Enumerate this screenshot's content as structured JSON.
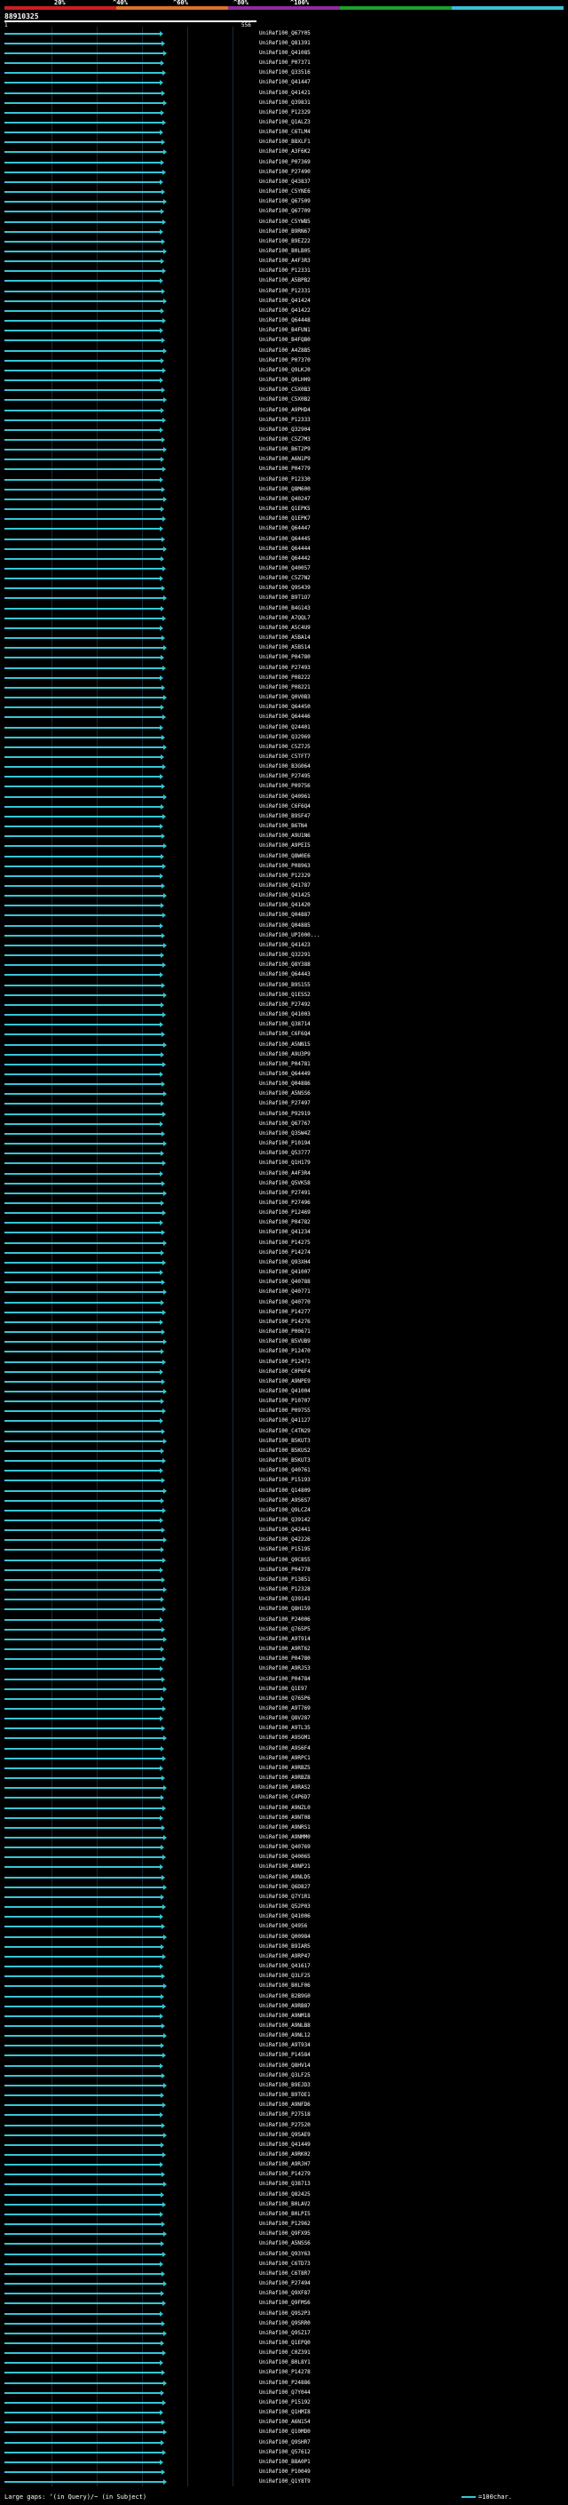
{
  "header": {
    "scale_labels": [
      "20%",
      "^40%",
      "^60%",
      "^80%",
      "^100%"
    ],
    "scale_colors": [
      "#d01c25",
      "#e0702a",
      "#8e2d9c",
      "#1aa12d",
      "#3bbfd8"
    ],
    "query_id": "88910325",
    "pos_start": "1",
    "pos_end": "556"
  },
  "colors": {
    "hit": "#35c6d6",
    "grid": "#1a2b36"
  },
  "labels": [
    "UniRef100_Q67Y05",
    "UniRef100_Q81391",
    "UniRef100_Q41085",
    "UniRef100_P07371",
    "UniRef100_Q33516",
    "UniRef100_Q41447",
    "UniRef100_Q41421",
    "UniRef100_Q39831",
    "UniRef100_P12329",
    "UniRef100_Q1ALZ3",
    "UniRef100_C6TLM4",
    "UniRef100_B8XLF1",
    "UniRef100_A3F6K2",
    "UniRef100_P07369",
    "UniRef100_P27490",
    "UniRef100_Q43837",
    "UniRef100_C5YNE6",
    "UniRef100_Q67509",
    "UniRef100_Q67709",
    "UniRef100_C5YWB5",
    "UniRef100_B9RN67",
    "UniRef100_B9EZ22",
    "UniRef100_B0LB05",
    "UniRef100_A4F3R3",
    "UniRef100_P12331",
    "UniRef100_A5BPB2",
    "UniRef100_P12331",
    "UniRef100_Q41424",
    "UniRef100_Q41422",
    "UniRef100_Q64448",
    "UniRef100_B4FUN1",
    "UniRef100_B4FQB0",
    "UniRef100_A4Z8B5",
    "UniRef100_P07370",
    "UniRef100_Q9LKJ0",
    "UniRef100_Q0LHH9",
    "UniRef100_C5X0B3",
    "UniRef100_C5X0B2",
    "UniRef100_A9PHD4",
    "UniRef100_P12333",
    "UniRef100_Q32904",
    "UniRef100_C5Z7M3",
    "UniRef100_B6T2P9",
    "UniRef100_A6N1P9",
    "UniRef100_P04779",
    "UniRef100_P12330",
    "UniRef100_Q8M600",
    "UniRef100_Q40247",
    "UniRef100_Q1EPK5",
    "UniRef100_Q1EPK7",
    "UniRef100_Q64447",
    "UniRef100_Q64445",
    "UniRef100_Q64444",
    "UniRef100_Q64442",
    "UniRef100_Q40057",
    "UniRef100_C5Z7N2",
    "UniRef100_Q9S439",
    "UniRef100_B9T1O7",
    "UniRef100_B4G143",
    "UniRef100_A7QQL7",
    "UniRef100_A5C4U9",
    "UniRef100_A5BA14",
    "UniRef100_A5BS14",
    "UniRef100_P04780",
    "UniRef100_P27493",
    "UniRef100_P08222",
    "UniRef100_P08221",
    "UniRef100_Q0V0B3",
    "UniRef100_Q64450",
    "UniRef100_Q64446",
    "UniRef100_Q24401",
    "UniRef100_Q32969",
    "UniRef100_C5Z7J5",
    "UniRef100_C5TFT7",
    "UniRef100_B3G064",
    "UniRef100_P27495",
    "UniRef100_P09756",
    "UniRef100_Q40961",
    "UniRef100_C6F6Q4",
    "UniRef100_B9SF47",
    "UniRef100_B6TN4",
    "UniRef100_A9U1N6",
    "UniRef100_A9PEI5",
    "UniRef100_Q8W0E6",
    "UniRef100_P08963",
    "UniRef100_P12329",
    "UniRef100_Q41787",
    "UniRef100_Q41425",
    "UniRef100_Q41420",
    "UniRef100_Q04887",
    "UniRef100_Q04885",
    "UniRef100_UPI000...",
    "UniRef100_Q41423",
    "UniRef100_Q32291",
    "UniRef100_Q8Y388",
    "UniRef100_Q64443",
    "UniRef100_B9S155",
    "UniRef100_Q1ESS2",
    "UniRef100_P27492",
    "UniRef100_Q41003",
    "UniRef100_Q38714",
    "UniRef100_C6F6Q4",
    "UniRef100_A5NN15",
    "UniRef100_A9U3P9",
    "UniRef100_P04781",
    "UniRef100_Q64449",
    "UniRef100_Q04886",
    "UniRef100_A5NSS6",
    "UniRef100_P27497",
    "UniRef100_P92919",
    "UniRef100_Q67767",
    "UniRef100_Q3SW4Z",
    "UniRef100_P10194",
    "UniRef100_Q53777",
    "UniRef100_Q1H179",
    "UniRef100_A4F3R4",
    "UniRef100_Q5VK58",
    "UniRef100_P27491",
    "UniRef100_P27496",
    "UniRef100_P12469",
    "UniRef100_P04782",
    "UniRef100_Q41234",
    "UniRef100_P14275",
    "UniRef100_P14274",
    "UniRef100_Q93XH4",
    "UniRef100_Q41007",
    "UniRef100_Q40788",
    "UniRef100_Q40771",
    "UniRef100_Q40770",
    "UniRef100_P14277",
    "UniRef100_P14276",
    "UniRef100_P00671",
    "UniRef100_B5VUB9",
    "UniRef100_P12470",
    "UniRef100_P12471",
    "UniRef100_C0P6F4",
    "UniRef100_A9NPE9",
    "UniRef100_Q41004",
    "UniRef100_P10707",
    "UniRef100_P09755",
    "UniRef100_Q41127",
    "UniRef100_C4TN29",
    "UniRef100_B5KUT3",
    "UniRef100_B5KUS2",
    "UniRef100_B5KUT3",
    "UniRef100_Q40761",
    "UniRef100_P15193",
    "UniRef100_Q14809",
    "UniRef100_A9S6S7",
    "UniRef100_Q9LCZ4",
    "UniRef100_Q39142",
    "UniRef100_Q42441",
    "UniRef100_Q42226",
    "UniRef100_P15195",
    "UniRef100_Q9C8S5",
    "UniRef100_P04778",
    "UniRef100_P13851",
    "UniRef100_P12328",
    "UniRef100_Q39141",
    "UniRef100_Q8H159",
    "UniRef100_P24006",
    "UniRef100_Q765P5",
    "UniRef100_A9T914",
    "UniRef100_A9RT62",
    "UniRef100_P04780",
    "UniRef100_A9RJ53",
    "UniRef100_P04784",
    "UniRef100_Q1E97",
    "UniRef100_Q765P6",
    "UniRef100_A9T769",
    "UniRef100_Q8V287",
    "UniRef100_A9TL35",
    "UniRef100_A9SGM1",
    "UniRef100_A9S6F4",
    "UniRef100_A9RPC1",
    "UniRef100_A9RBZ5",
    "UniRef100_A9RBZ8",
    "UniRef100_A9RAS2",
    "UniRef100_C4P6D7",
    "UniRef100_A9NZL0",
    "UniRef100_A9NT08",
    "UniRef100_A9NRS1",
    "UniRef100_A9NMM0",
    "UniRef100_Q40769",
    "UniRef100_Q40065",
    "UniRef100_A9NP21",
    "UniRef100_A9NLD5",
    "UniRef100_Q6D827",
    "UniRef100_Q7Y1R1",
    "UniRef100_Q52P03",
    "UniRef100_Q41006",
    "UniRef100_Q4956",
    "UniRef100_Q00984",
    "UniRef100_B9IAR5",
    "UniRef100_A9RP47",
    "UniRef100_Q41617",
    "UniRef100_Q3LF25",
    "UniRef100_B0LF06",
    "UniRef100_B2B9G0",
    "UniRef100_A9RB87",
    "UniRef100_A9NM18",
    "UniRef100_A9NLB8",
    "UniRef100_A9NL12",
    "UniRef100_A9T934",
    "UniRef100_P14584",
    "UniRef100_Q8HV14",
    "UniRef100_Q3LF25",
    "UniRef100_B9EJD3",
    "UniRef100_B9TOE1",
    "UniRef100_A9NFD6",
    "UniRef100_P27518",
    "UniRef100_P27520",
    "UniRef100_Q9SAE9",
    "UniRef100_Q41449",
    "UniRef100_A9RK02",
    "UniRef100_A9RJH7",
    "UniRef100_P14279",
    "UniRef100_Q38713",
    "UniRef100_Q82425",
    "UniRef100_B0LAV2",
    "UniRef100_B0LPI5",
    "UniRef100_P12962",
    "UniRef100_Q9FX95",
    "UniRef100_A5NSS6",
    "UniRef100_Q93Y63",
    "UniRef100_C6TD73",
    "UniRef100_C6T8R7",
    "UniRef100_P27494",
    "UniRef100_Q9XF87",
    "UniRef100_Q9FMS6",
    "UniRef100_Q9S2P3",
    "UniRef100_Q9SRR0",
    "UniRef100_Q9SZ17",
    "UniRef100_Q1EPQ0",
    "UniRef100_C0Z391",
    "UniRef100_B0L8Y1",
    "UniRef100_P14278",
    "UniRef100_P24886",
    "UniRef100_Q7Y044",
    "UniRef100_P15192",
    "UniRef100_Q1HMI8",
    "UniRef100_A6N154",
    "UniRef100_Q10MD0",
    "UniRef100_Q9SHR7",
    "UniRef100_Q57612",
    "UniRef100_B8A0P1",
    "UniRef100_P10049",
    "UniRef100_Q1Y8T9"
  ],
  "footer": {
    "large_gaps": "Large gaps: ‘(in Query)/~ (in Subject)",
    "legend": "=100char."
  }
}
